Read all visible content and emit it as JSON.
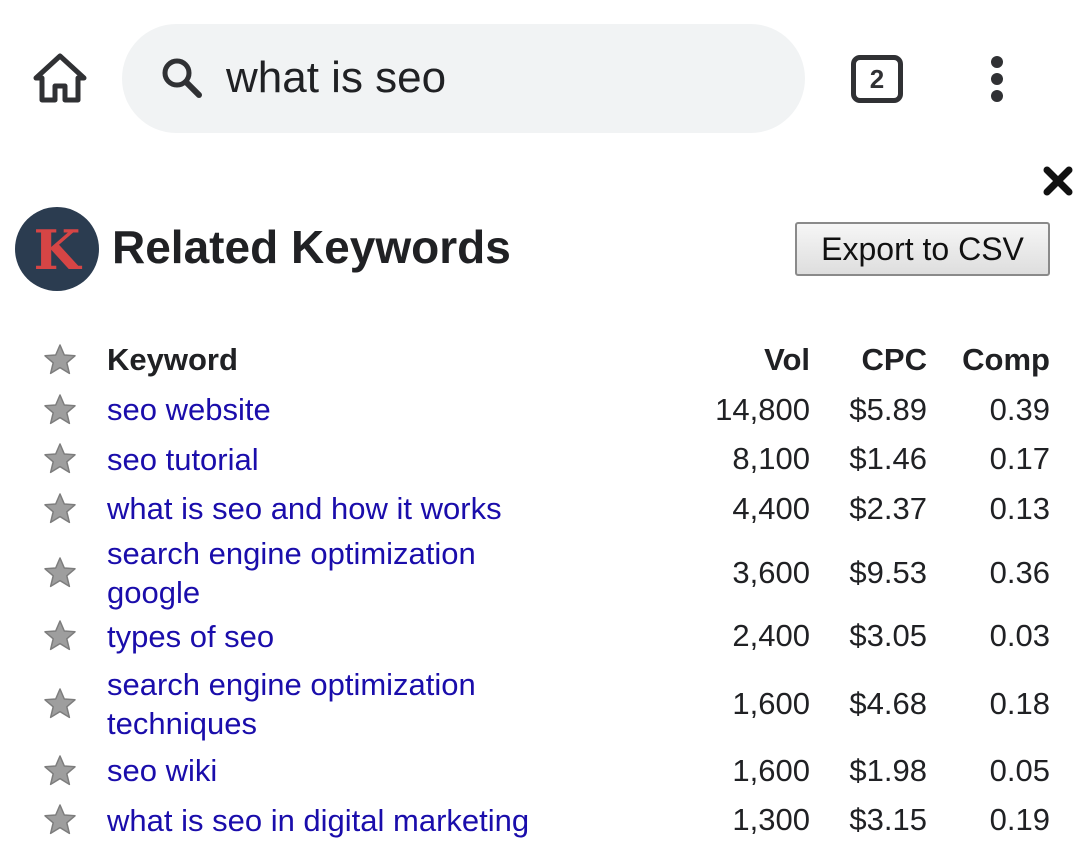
{
  "search": {
    "query": "what is seo"
  },
  "tabs": {
    "count": "2"
  },
  "panel": {
    "title": "Related Keywords",
    "logo_letter": "K",
    "export_label": "Export to CSV"
  },
  "table": {
    "headers": {
      "keyword": "Keyword",
      "vol": "Vol",
      "cpc": "CPC",
      "comp": "Comp"
    },
    "rows": [
      {
        "keyword": "seo website",
        "vol": "14,800",
        "cpc": "$5.89",
        "comp": "0.39"
      },
      {
        "keyword": "seo tutorial",
        "vol": "8,100",
        "cpc": "$1.46",
        "comp": "0.17"
      },
      {
        "keyword": "what is seo and how it works",
        "vol": "4,400",
        "cpc": "$2.37",
        "comp": "0.13"
      },
      {
        "keyword": "search engine optimization google",
        "vol": "3,600",
        "cpc": "$9.53",
        "comp": "0.36"
      },
      {
        "keyword": "types of seo",
        "vol": "2,400",
        "cpc": "$3.05",
        "comp": "0.03"
      },
      {
        "keyword": "search engine optimization techniques",
        "vol": "1,600",
        "cpc": "$4.68",
        "comp": "0.18"
      },
      {
        "keyword": "seo wiki",
        "vol": "1,600",
        "cpc": "$1.98",
        "comp": "0.05"
      },
      {
        "keyword": "what is seo in digital marketing",
        "vol": "1,300",
        "cpc": "$3.15",
        "comp": "0.19"
      }
    ]
  },
  "icons": {
    "home": "home-icon",
    "search": "search-icon",
    "menu": "more-vert-icon",
    "close": "close-icon",
    "favorite": "star-icon"
  },
  "colors": {
    "link": "#1a0dab",
    "search_bg": "#f1f3f4",
    "logo_bg": "#2b3c50",
    "logo_letter": "#d64545",
    "star": "#9e9e9e"
  }
}
